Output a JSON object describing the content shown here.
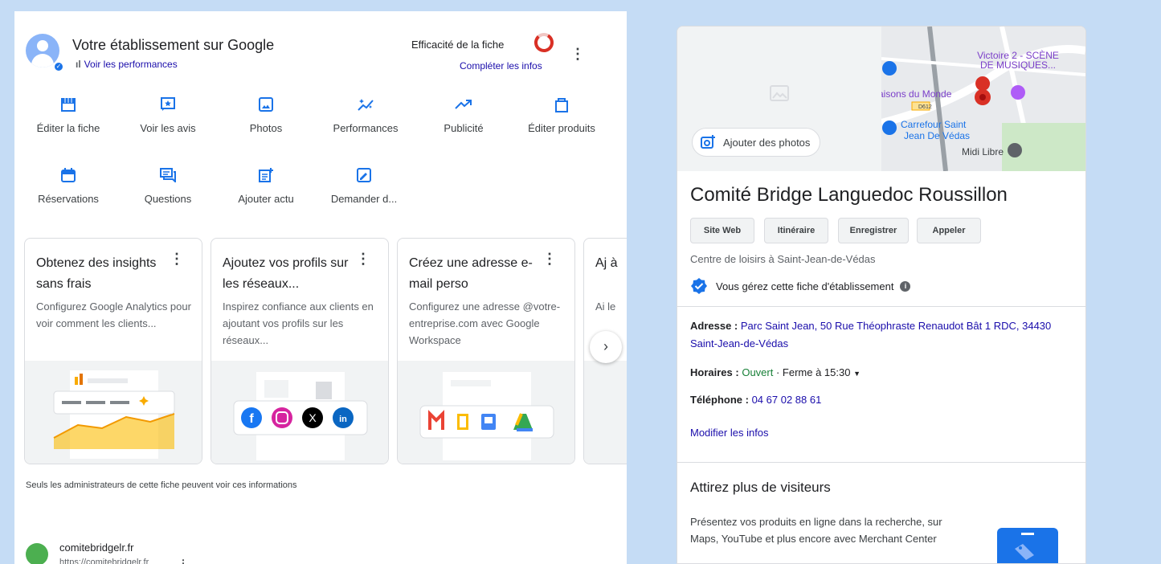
{
  "header": {
    "title": "Votre établissement sur Google",
    "performance_link": "Voir les performances",
    "efficiency_label": "Efficacité de la fiche",
    "complete_link": "Compléter les infos"
  },
  "actions": [
    {
      "label": "Éditer la fiche",
      "icon": "storefront-icon"
    },
    {
      "label": "Voir les avis",
      "icon": "star-review-icon"
    },
    {
      "label": "Photos",
      "icon": "photo-icon"
    },
    {
      "label": "Performances",
      "icon": "sparkle-chart-icon"
    },
    {
      "label": "Publicité",
      "icon": "trending-up-icon"
    },
    {
      "label": "Éditer produits",
      "icon": "shopping-bag-icon"
    },
    {
      "label": "Réservations",
      "icon": "calendar-icon"
    },
    {
      "label": "Questions",
      "icon": "chat-icon"
    },
    {
      "label": "Ajouter actu",
      "icon": "add-post-icon"
    },
    {
      "label": "Demander d...",
      "icon": "request-review-icon"
    }
  ],
  "cards": [
    {
      "title": "Obtenez des insights sans frais",
      "desc": "Configurez Google Analytics pour voir comment les clients..."
    },
    {
      "title": "Ajoutez vos profils sur les réseaux...",
      "desc": "Inspirez confiance aux clients en ajoutant vos profils sur les réseaux..."
    },
    {
      "title": "Créez une adresse e-mail perso",
      "desc": "Configurez une adresse @votre-entreprise.com avec Google Workspace"
    },
    {
      "title": "Aj à",
      "desc": "Ai le"
    }
  ],
  "admin_note": "Seuls les administrateurs de cette fiche peuvent voir ces informations",
  "website": {
    "name": "comitebridgelr.fr",
    "url": "https://comitebridgelr.fr"
  },
  "map": {
    "add_photos": "Ajouter des photos",
    "labels": [
      "Victoire 2 - SCÈNE",
      "DE MUSIQUES...",
      "aisons du Monde",
      "D612",
      "Carrefour Saint",
      "Jean De Védas",
      "Midi Libre"
    ]
  },
  "business": {
    "name": "Comité Bridge Languedoc Roussillon",
    "buttons": [
      "Site Web",
      "Itinéraire",
      "Enregistrer",
      "Appeler"
    ],
    "category": "Centre de loisirs à Saint-Jean-de-Védas",
    "managed": "Vous gérez cette fiche d'établissement",
    "address_label": "Adresse :",
    "address": "Parc Saint Jean, 50 Rue Théophraste Renaudot Bât 1 RDC, 34430 Saint-Jean-de-Védas",
    "hours_label": "Horaires :",
    "hours_open": "Ouvert",
    "hours_close": "· Ferme à 15:30",
    "phone_label": "Téléphone :",
    "phone": "04 67 02 88 61",
    "modify": "Modifier les infos"
  },
  "promo": {
    "title": "Attirez plus de visiteurs",
    "desc": "Présentez vos produits en ligne dans la recherche, sur Maps, YouTube et plus encore avec Merchant Center"
  },
  "colors": {
    "link": "#1a0dab",
    "accent": "#1a73e8",
    "open": "#188038",
    "background": "#c5dcf5"
  }
}
